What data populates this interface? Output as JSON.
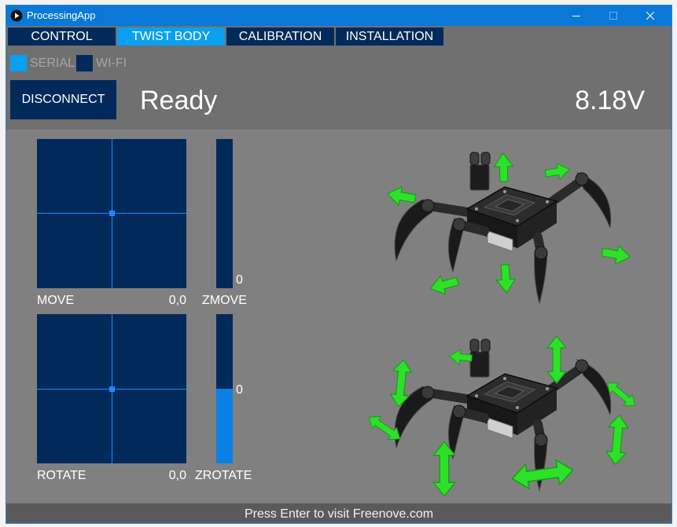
{
  "window": {
    "title": "ProcessingApp",
    "icons": {
      "app": "processing-app-icon",
      "minimize": "minimize-icon",
      "maximize": "maximize-icon",
      "close": "close-icon"
    }
  },
  "tabs": [
    {
      "label": "CONTROL",
      "active": false
    },
    {
      "label": "TWIST BODY",
      "active": true
    },
    {
      "label": "CALIBRATION",
      "active": false
    },
    {
      "label": "INSTALLATION",
      "active": false
    }
  ],
  "connection": {
    "serial": {
      "label": "SERIAL",
      "checked": true
    },
    "wifi": {
      "label": "WI-FI",
      "checked": false
    },
    "disconnect_label": "DISCONNECT",
    "status": "Ready",
    "voltage": "8.18V"
  },
  "twist": {
    "move": {
      "label": "MOVE",
      "value": "0,0"
    },
    "zmove": {
      "label": "ZMOVE",
      "value": "0",
      "level": 0
    },
    "rotate": {
      "label": "ROTATE",
      "value": "0,0"
    },
    "zrotate": {
      "label": "ZROTATE",
      "value": "0",
      "level": 0.5
    }
  },
  "footer": {
    "text": "Press Enter to visit Freenove.com"
  },
  "colors": {
    "title_bar": "#0a78d6",
    "navy": "#012a5b",
    "active_tab": "#0aa0f0",
    "crosshair": "#1e88ff",
    "slider_fill": "#0b80e4",
    "arrow": "#2fe02b"
  }
}
